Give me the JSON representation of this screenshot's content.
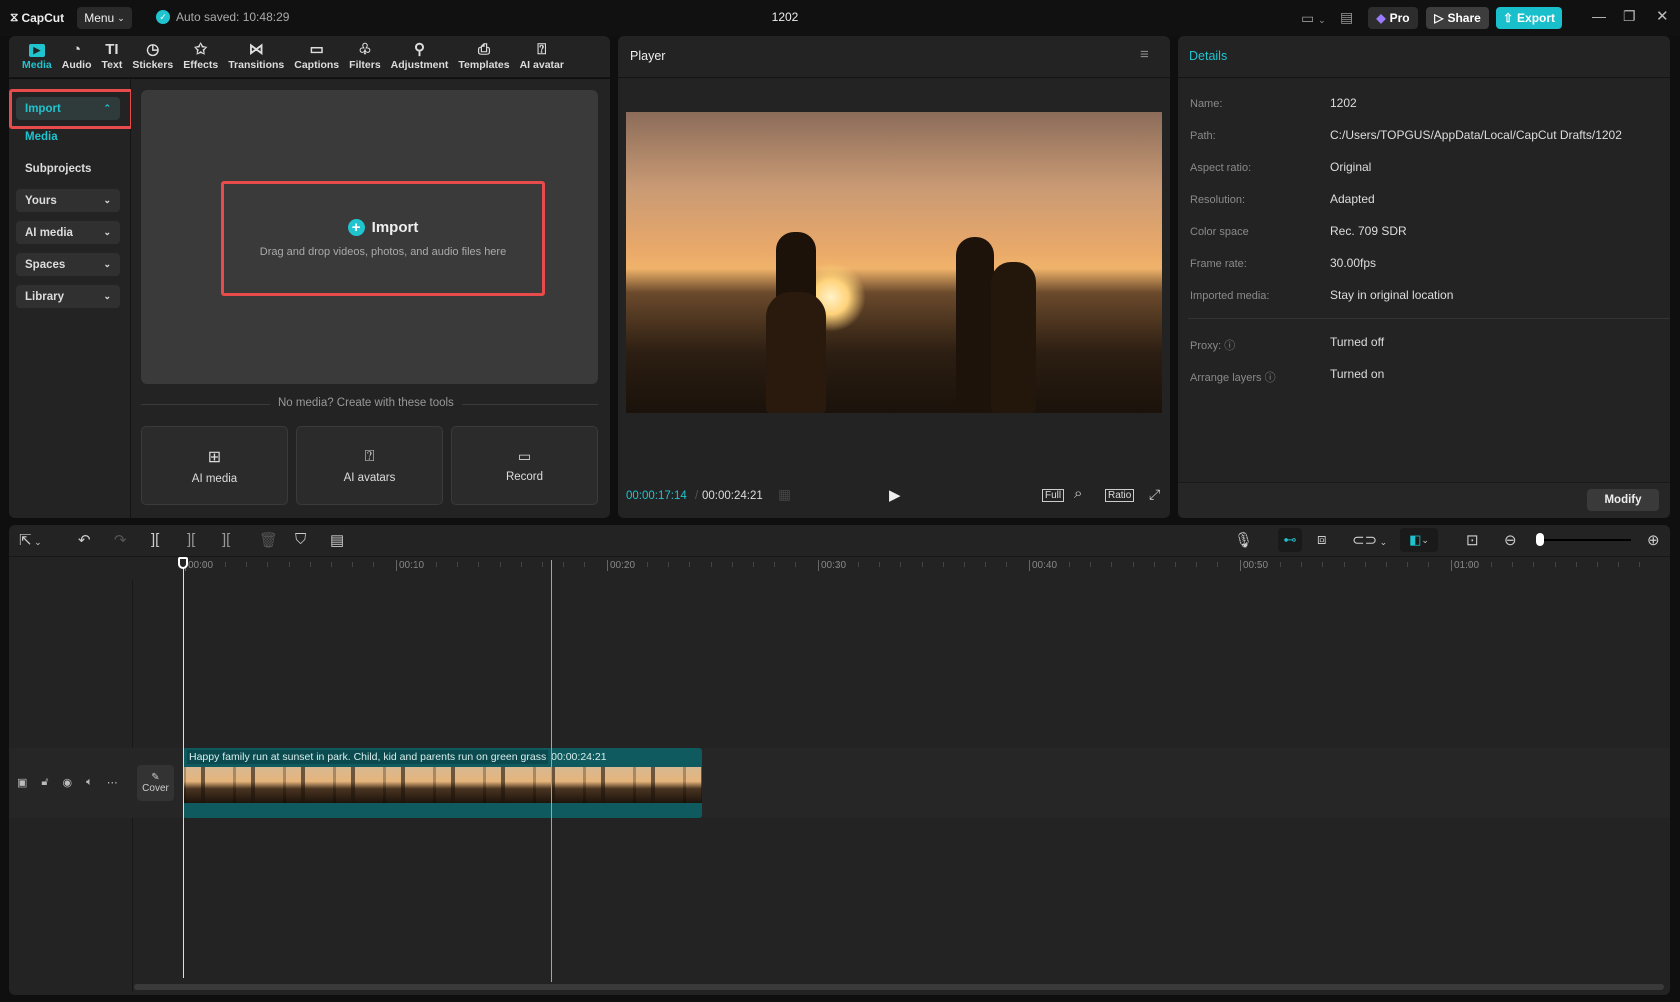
{
  "app": {
    "logo": "CapCut",
    "menu": "Menu",
    "autosave": "Auto saved: 10:48:29",
    "title": "1202",
    "pro": "Pro",
    "share": "Share",
    "export": "Export"
  },
  "tabs": [
    {
      "label": "Media",
      "icon": "media-icon"
    },
    {
      "label": "Audio",
      "icon": "audio-icon"
    },
    {
      "label": "Text",
      "icon": "text-icon"
    },
    {
      "label": "Stickers",
      "icon": "stickers-icon"
    },
    {
      "label": "Effects",
      "icon": "effects-icon"
    },
    {
      "label": "Transitions",
      "icon": "transitions-icon"
    },
    {
      "label": "Captions",
      "icon": "captions-icon"
    },
    {
      "label": "Filters",
      "icon": "filters-icon"
    },
    {
      "label": "Adjustment",
      "icon": "adjustment-icon"
    },
    {
      "label": "Templates",
      "icon": "templates-icon"
    },
    {
      "label": "AI avatar",
      "icon": "ai-avatar-icon"
    }
  ],
  "sidebar": {
    "import": "Import",
    "media": "Media",
    "subprojects": "Subprojects",
    "yours": "Yours",
    "ai_media": "AI media",
    "spaces": "Spaces",
    "library": "Library"
  },
  "import_zone": {
    "title": "Import",
    "subtitle": "Drag and drop videos, photos, and audio files here"
  },
  "tools": {
    "divider": "No media? Create with these tools",
    "ai_media": "AI media",
    "ai_avatars": "AI avatars",
    "record": "Record"
  },
  "player": {
    "title": "Player",
    "current": "00:00:17:14",
    "separator": "/",
    "total": "00:00:24:21",
    "full": "Full",
    "ratio": "Ratio"
  },
  "details": {
    "title": "Details",
    "rows": [
      {
        "label": "Name:",
        "value": "1202"
      },
      {
        "label": "Path:",
        "value": "C:/Users/TOPGUS/AppData/Local/CapCut Drafts/1202"
      },
      {
        "label": "Aspect ratio:",
        "value": "Original"
      },
      {
        "label": "Resolution:",
        "value": "Adapted"
      },
      {
        "label": "Color space",
        "value": "Rec. 709 SDR"
      },
      {
        "label": "Frame rate:",
        "value": "30.00fps"
      },
      {
        "label": "Imported media:",
        "value": "Stay in original location"
      }
    ],
    "proxy_label": "Proxy:",
    "proxy_value": "Turned off",
    "arrange_label": "Arrange layers",
    "arrange_value": "Turned on",
    "modify": "Modify"
  },
  "timeline": {
    "ruler": [
      "00:00",
      "00:10",
      "00:20",
      "00:30",
      "00:40",
      "00:50",
      "01:00"
    ],
    "cover": "Cover",
    "clip": {
      "title": "Happy family run at sunset in park. Child, kid and parents run on green grass",
      "duration": "00:00:24:21"
    },
    "zoom_level": 0.0
  },
  "colors": {
    "accent": "#1fc4cf",
    "highlight": "#e84b4b",
    "clip": "#0e5a5e",
    "playhead": "#d9a318"
  }
}
